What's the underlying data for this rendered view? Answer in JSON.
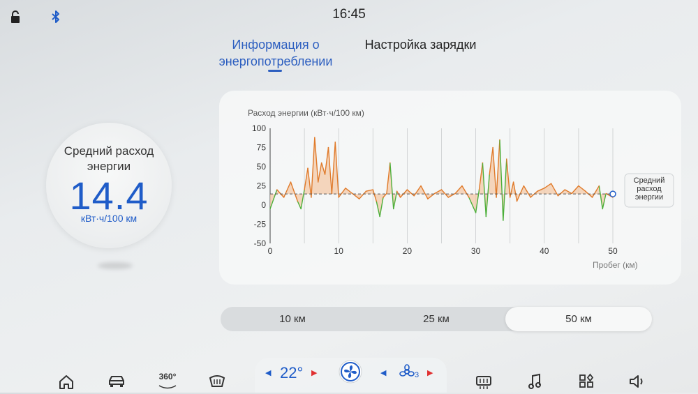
{
  "status_bar": {
    "time": "16:45"
  },
  "tabs": [
    {
      "label": "Информация о энергопотреблении",
      "active": true
    },
    {
      "label": "Настройка зарядки",
      "active": false
    }
  ],
  "average": {
    "label": "Средний расход энергии",
    "value": "14.4",
    "unit": "кВт·ч/100 км"
  },
  "chart_data": {
    "type": "line",
    "title": "Расход энергии (кВт·ч/100 км)",
    "xlabel": "Пробег (км)",
    "ylabel": "Расход энергии (кВт·ч/100 км)",
    "xlim": [
      0,
      50
    ],
    "ylim": [
      -50,
      100
    ],
    "x_ticks": [
      "0",
      "10",
      "20",
      "30",
      "40",
      "50"
    ],
    "y_ticks": [
      "100",
      "75",
      "50",
      "25",
      "0",
      "-25",
      "-50"
    ],
    "average_line": {
      "value": 14.4,
      "label": "Средний расход энергии"
    },
    "colors": {
      "positive": "#e07a2a",
      "negative": "#4caf3a",
      "fill": "#f3c9a8",
      "average": "#555555"
    },
    "series": [
      {
        "x": [
          0,
          1,
          2,
          3,
          4,
          4.5,
          5,
          5.5,
          6,
          6.5,
          7,
          7.5,
          8,
          8.5,
          9,
          9.5,
          10,
          11,
          12,
          13,
          14,
          15,
          15.5,
          16,
          16.5,
          17,
          17.5,
          18,
          18.5,
          19,
          20,
          21,
          22,
          23,
          24,
          25,
          26,
          27,
          28,
          29,
          30,
          30.5,
          31,
          31.5,
          32,
          32.5,
          33,
          33.5,
          34,
          34.5,
          35,
          35.5,
          36,
          36.5,
          37,
          38,
          39,
          40,
          41,
          42,
          43,
          44,
          45,
          46,
          47,
          48,
          48.5,
          49,
          50
        ],
        "y": [
          -5,
          20,
          10,
          30,
          5,
          -5,
          20,
          48,
          10,
          88,
          30,
          55,
          40,
          75,
          15,
          82,
          10,
          22,
          15,
          8,
          18,
          20,
          5,
          -15,
          10,
          15,
          55,
          -5,
          18,
          10,
          20,
          12,
          25,
          8,
          15,
          20,
          10,
          15,
          25,
          10,
          -10,
          20,
          55,
          -15,
          40,
          75,
          10,
          85,
          -20,
          60,
          10,
          30,
          5,
          15,
          25,
          10,
          18,
          22,
          28,
          12,
          20,
          15,
          25,
          18,
          10,
          25,
          -5,
          15,
          10
        ]
      }
    ]
  },
  "range_options": [
    {
      "label": "10 км",
      "selected": false
    },
    {
      "label": "25 км",
      "selected": false
    },
    {
      "label": "50 км",
      "selected": true
    }
  ],
  "climate": {
    "temperature": "22°",
    "fan_level": "3"
  },
  "dock": {
    "camera_label": "360°"
  }
}
